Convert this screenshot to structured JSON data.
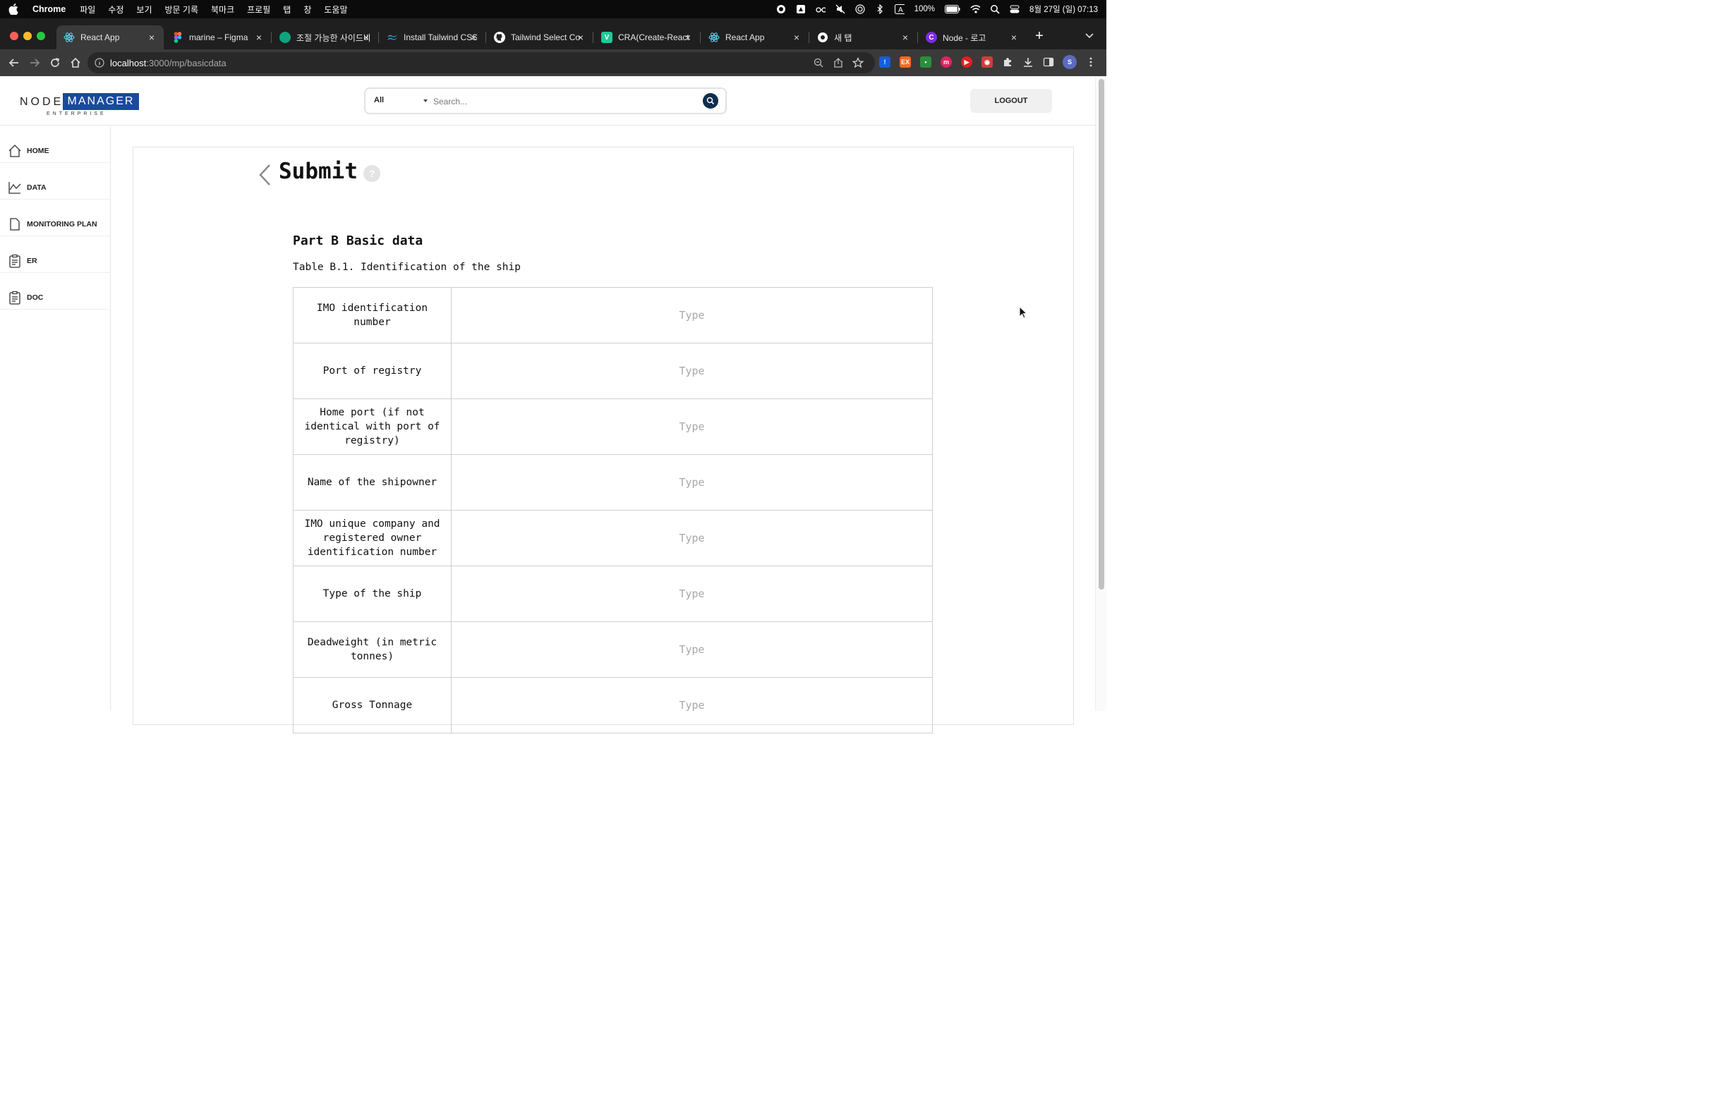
{
  "menubar": {
    "app_name": "Chrome",
    "items": [
      "파일",
      "수정",
      "보기",
      "방문 기록",
      "북마크",
      "프로필",
      "탭",
      "창",
      "도움말"
    ],
    "battery": "100%",
    "datetime": "8월 27일 (일) 07:13"
  },
  "tabs": [
    {
      "title": "React App",
      "favicon": "react-icon",
      "color": "#61dafb",
      "active": true
    },
    {
      "title": "marine – Figma",
      "favicon": "figma-icon",
      "color": "#f24e1e"
    },
    {
      "title": "조절 가능한 사이드바",
      "favicon": "chatgpt-icon",
      "color": "#10a37f"
    },
    {
      "title": "Install Tailwind CSS",
      "favicon": "tailwind-icon",
      "color": "#38bdf8"
    },
    {
      "title": "Tailwind Select Co",
      "favicon": "github-icon",
      "color": "#ffffff"
    },
    {
      "title": "CRA(Create-React",
      "favicon": "velog-icon",
      "color": "#20c997"
    },
    {
      "title": "React App",
      "favicon": "react-icon",
      "color": "#61dafb"
    },
    {
      "title": "새 탭",
      "favicon": "chrome-icon",
      "color": "#ffffff"
    },
    {
      "title": "Node - 로고",
      "favicon": "canva-icon",
      "color": "#7d2ae8"
    }
  ],
  "address": {
    "host": "localhost",
    "path": ":3000/mp/basicdata"
  },
  "header": {
    "logo_node": "NODE",
    "logo_manager": "MANAGER",
    "logo_enterprise": "ENTERPRISE",
    "search_scope": "All",
    "search_placeholder": "Search...",
    "logout_label": "LOGOUT"
  },
  "sidebar": {
    "items": [
      {
        "label": "HOME",
        "icon": "home-icon"
      },
      {
        "label": "DATA",
        "icon": "chart-icon"
      },
      {
        "label": "MONITORING PLAN",
        "icon": "document-icon"
      },
      {
        "label": "ER",
        "icon": "clipboard-icon"
      },
      {
        "label": "DOC",
        "icon": "clipboard-icon"
      }
    ]
  },
  "main": {
    "title": "Submit",
    "help_label": "?",
    "part_title": "Part B Basic data",
    "table_caption": "Table B.1. Identification of the ship",
    "rows": [
      {
        "label": "IMO identification number",
        "placeholder": "Type"
      },
      {
        "label": "Port of registry",
        "placeholder": "Type"
      },
      {
        "label": "Home port (if not identical with port of registry)",
        "placeholder": "Type"
      },
      {
        "label": "Name of the shipowner",
        "placeholder": "Type"
      },
      {
        "label": "IMO unique company and registered owner identification number",
        "placeholder": "Type"
      },
      {
        "label": "Type of the ship",
        "placeholder": "Type"
      },
      {
        "label": "Deadweight (in metric tonnes)",
        "placeholder": "Type"
      },
      {
        "label": "Gross Tonnage",
        "placeholder": "Type"
      }
    ]
  }
}
